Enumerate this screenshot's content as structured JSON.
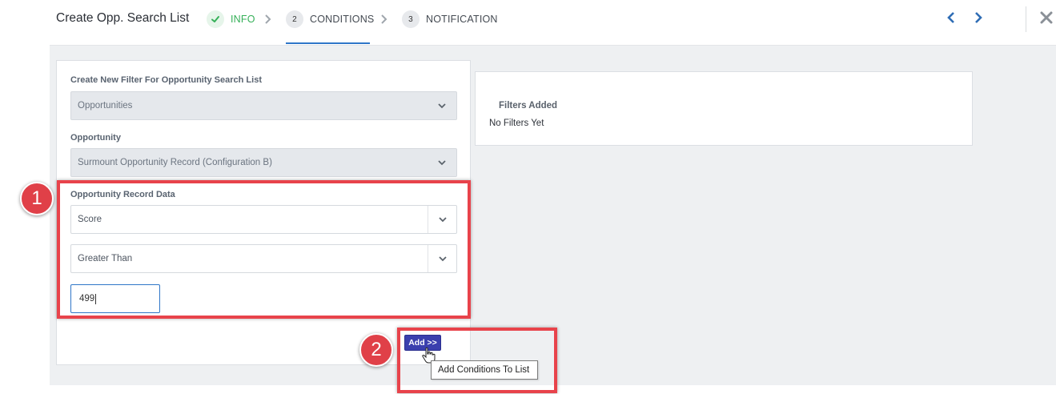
{
  "header": {
    "title": "Create Opp. Search List",
    "steps": [
      {
        "number": "",
        "label": "INFO",
        "state": "complete"
      },
      {
        "number": "2",
        "label": "CONDITIONS",
        "state": "active"
      },
      {
        "number": "3",
        "label": "NOTIFICATION",
        "state": "upcoming"
      }
    ],
    "icons": {
      "complete": "check-icon",
      "separator": "chevron-right-icon",
      "prev": "chevron-left-icon",
      "next": "chevron-right-icon",
      "close": "close-icon"
    }
  },
  "filter_form": {
    "heading": "Create New Filter For Opportunity Search List",
    "type_select": {
      "value": "Opportunities",
      "disabled": true
    },
    "opportunity_label": "Opportunity",
    "opportunity_select": {
      "value": "Surmount Opportunity Record (Configuration B)",
      "disabled": true
    },
    "record_data_label": "Opportunity Record Data",
    "field_select": {
      "value": "Score"
    },
    "operator_select": {
      "value": "Greater Than"
    },
    "value_input": {
      "value": "499"
    }
  },
  "filters_panel": {
    "title": "Filters Added",
    "empty_text": "No Filters Yet"
  },
  "actions": {
    "add_label": "Add >>",
    "add_tooltip": "Add Conditions To List"
  },
  "annotations": {
    "badge1": "1",
    "badge2": "2",
    "highlight_color": "#e8434b"
  },
  "colors": {
    "accent_blue": "#2f76c8",
    "add_button": "#3b3fae",
    "complete_green": "#35b058"
  }
}
